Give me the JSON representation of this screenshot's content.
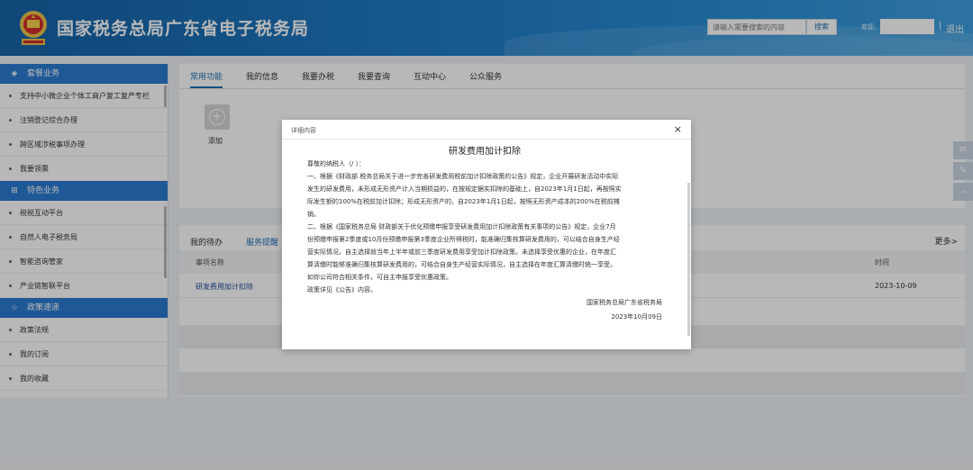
{
  "header": {
    "site_title": "国家税务总局广东省电子税务局",
    "search_placeholder": "请输入需要搜索的内容",
    "search_button": "搜索",
    "welcome": "欢迎,",
    "divider": "|",
    "logout": "退出",
    "logo_icon": "tax-emblem-icon"
  },
  "sidebar": {
    "sections": [
      {
        "title": "套餐业务",
        "icon": "layers-icon",
        "items": [
          "支持中小微企业个体工商户复工复产专栏",
          "注销登记综合办理",
          "跨区域涉税事项办理",
          "我要领票"
        ]
      },
      {
        "title": "特色业务",
        "icon": "grid-icon",
        "items": [
          "税税互动平台",
          "自然人电子税务局",
          "智能咨询管家",
          "产业链智联平台"
        ]
      },
      {
        "title": "政策速递",
        "icon": "star-icon",
        "items": [
          "政策法规",
          "我的订阅",
          "我的收藏"
        ]
      }
    ]
  },
  "main": {
    "tabs": [
      "常用功能",
      "我的信息",
      "我要办税",
      "我要查询",
      "互动中心",
      "公众服务"
    ],
    "active_tab": 0,
    "add_label": "添加",
    "add_symbol": "+"
  },
  "todo": {
    "tabs": [
      "我的待办",
      "服务提醒"
    ],
    "active_tab": 1,
    "more": "更多>",
    "columns": [
      "事项名称",
      "时间"
    ],
    "rows": [
      {
        "name": "研发费用加计扣除",
        "time": "2023-10-09"
      }
    ]
  },
  "float_tools": [
    "chat-icon",
    "edit-icon",
    "up-arrow-icon"
  ],
  "modal": {
    "title": "详细内容",
    "close": "×",
    "heading": "研发费用加计扣除",
    "salutation": "尊敬的纳税人（/                                           ）：",
    "para1_lines": [
      "一、根据《财政部 税务总局关于进一步完善研发费用税前加计扣除政策的公告》规定，企业开展研发活动中实际",
      "发生的研发费用，未形成无形资产计入当期损益的，在按规定据实扣除的基础上，自2023年1月1日起，再按照实",
      "际发生额的100%在税前加计扣除；形成无形资产的，自2023年1月1日起，按照无形资产成本的200%在税前摊",
      "销。"
    ],
    "para2_lines": [
      "二、根据《国家税务总局 财政部关于优化预缴申报享受研发费用加计扣除政策有关事项的公告》规定，企业7月",
      "份预缴申报第2季度或10月份预缴申报第3季度企业所得税时，能准确归集核算研发费用的，可以结合自身生产经",
      "营实际情况，自主选择就当年上半年或前三季度研发费用享受加计扣除政策。未选择享受优惠的企业，在年度汇",
      "算清缴时能够准确归集核算研发费用的，可结合自身生产经营实际情况，自主选择在年度汇算清缴时统一享受。",
      "如你公司符合相关条件，可自主申报享受优惠政策。"
    ],
    "para3": "政策详见《公告》内容。",
    "signature": "国家税务总局广东省税务局",
    "date": "2023年10月09日"
  }
}
